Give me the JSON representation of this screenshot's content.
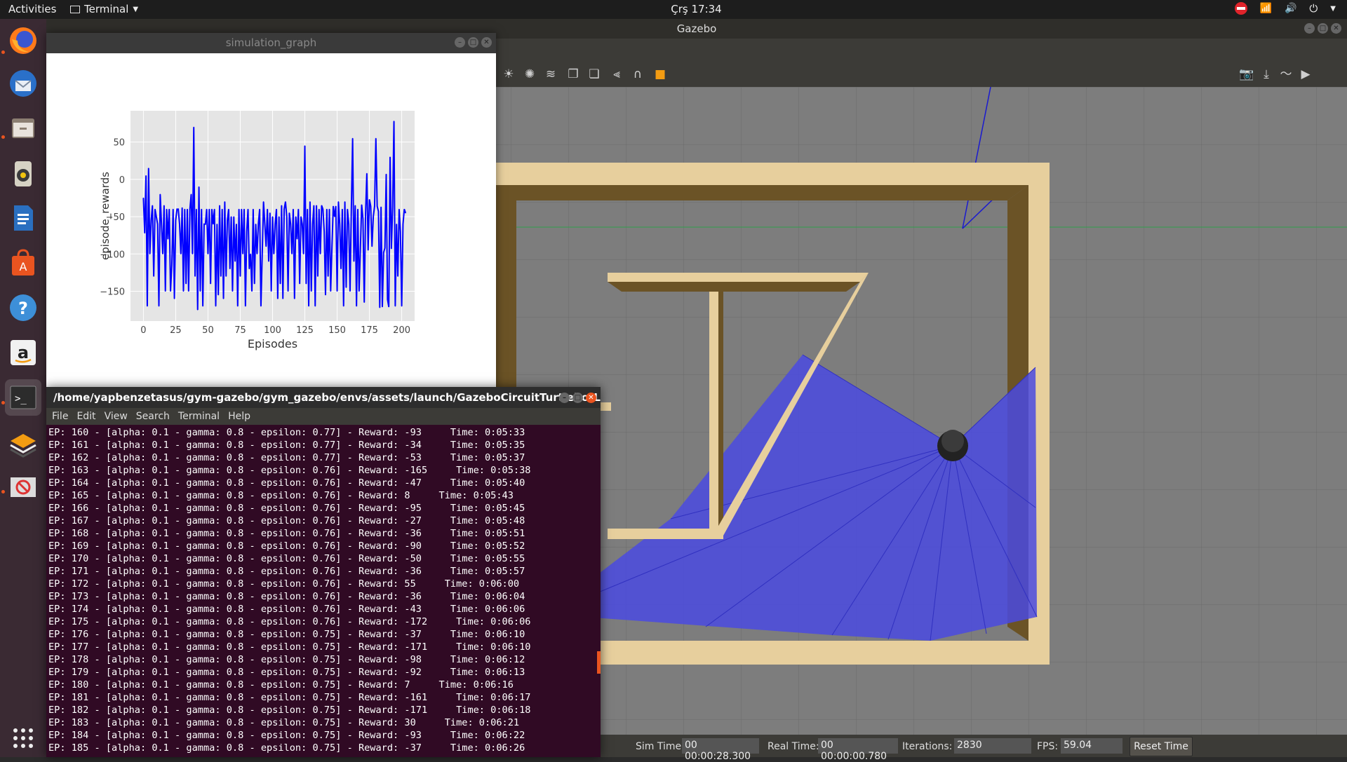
{
  "topbar": {
    "activities": "Activities",
    "app_menu": "Terminal",
    "clock": "Çrş 17:34"
  },
  "dock": {
    "items": [
      "firefox-icon",
      "thunderbird-icon",
      "files-icon",
      "rhythmbox-icon",
      "writer-icon",
      "software-center-icon",
      "help-icon",
      "amazon-icon",
      "terminal-icon",
      "gazebo-icon",
      "system-icon"
    ]
  },
  "gazebo": {
    "title": "Gazebo",
    "status": {
      "sim_time_label": "Sim Time:",
      "sim_time": "00 00:00:28.300",
      "real_time_label": "Real Time:",
      "real_time": "00 00:00:00.780",
      "iterations_label": "Iterations:",
      "iterations": "2830",
      "fps_label": "FPS:",
      "fps": "59.04",
      "reset_label": "Reset Time"
    }
  },
  "simgraph": {
    "title": "simulation_graph",
    "chart_data": {
      "type": "line",
      "xlabel": "Episodes",
      "ylabel": "episode_rewards",
      "xlim": [
        -10,
        210
      ],
      "ylim": [
        -190,
        92
      ],
      "xticks": [
        0,
        25,
        50,
        75,
        100,
        125,
        150,
        175,
        200
      ],
      "yticks": [
        50,
        0,
        -50,
        -100,
        -150
      ],
      "ytick_labels": [
        "50",
        "0",
        "−50",
        "−100",
        "−150"
      ],
      "color": "#0000ff",
      "series": [
        {
          "values": [
            -25,
            -72,
            5,
            -170,
            15,
            -100,
            -55,
            -35,
            -130,
            -40,
            -50,
            -60,
            -170,
            -20,
            -60,
            -100,
            -35,
            -150,
            -40,
            -80,
            -40,
            -150,
            -115,
            -40,
            -160,
            -55,
            -40,
            -40,
            -60,
            -100,
            -38,
            -150,
            -40,
            -140,
            -40,
            -150,
            -40,
            -20,
            -100,
            70,
            -130,
            -40,
            -175,
            -10,
            -150,
            -40,
            -170,
            -60,
            -60,
            -40,
            -100,
            -40,
            -140,
            -40,
            -60,
            -40,
            -170,
            -60,
            -155,
            -35,
            -130,
            -40,
            -160,
            -30,
            -130,
            -55,
            -40,
            -120,
            -50,
            -150,
            -50,
            -110,
            -60,
            -170,
            -40,
            -130,
            -40,
            -100,
            -40,
            -170,
            -70,
            -40,
            -120,
            -100,
            -150,
            -40,
            -140,
            -60,
            -100,
            -60,
            -40,
            -170,
            -100,
            -30,
            -60,
            -90,
            -40,
            -110,
            -45,
            -150,
            -50,
            -100,
            -60,
            -40,
            -160,
            -50,
            -140,
            -35,
            -160,
            -40,
            -30,
            -50,
            -150,
            -45,
            -60,
            -100,
            -40,
            -160,
            -50,
            -80,
            -40,
            -140,
            -50,
            -60,
            -100,
            45,
            -140,
            -40,
            -170,
            -30,
            -150,
            -60,
            -35,
            -170,
            -35,
            -130,
            -40,
            -100,
            -35,
            -40,
            -70,
            -155,
            -40,
            -130,
            -40,
            -150,
            -90,
            -36,
            -50,
            -36,
            -150,
            -30,
            -60,
            -120,
            -40,
            -170,
            -30,
            -145,
            -40,
            -60,
            -150,
            -40,
            55,
            -110,
            -35,
            -170,
            -40,
            -150,
            -93,
            -34,
            -53,
            -165,
            -47,
            8,
            -95,
            -27,
            -36,
            -90,
            -50,
            -36,
            55,
            -36,
            -43,
            -172,
            -37,
            -171,
            -98,
            -92,
            7,
            -161,
            -171,
            30,
            -93,
            -37,
            78,
            -170,
            -60,
            -130,
            -40,
            -70,
            -170,
            -60,
            -40,
            -45
          ]
        }
      ]
    }
  },
  "terminal": {
    "title": "/home/yapbenzetasus/gym-gazebo/gym_gazebo/envs/assets/launch/GazeboCircuitTurtlebotLidar_...",
    "menu": [
      "File",
      "Edit",
      "View",
      "Search",
      "Terminal",
      "Help"
    ],
    "lines": [
      "EP: 160 - [alpha: 0.1 - gamma: 0.8 - epsilon: 0.77] - Reward: -93     Time: 0:05:33",
      "EP: 161 - [alpha: 0.1 - gamma: 0.8 - epsilon: 0.77] - Reward: -34     Time: 0:05:35",
      "EP: 162 - [alpha: 0.1 - gamma: 0.8 - epsilon: 0.77] - Reward: -53     Time: 0:05:37",
      "EP: 163 - [alpha: 0.1 - gamma: 0.8 - epsilon: 0.76] - Reward: -165     Time: 0:05:38",
      "EP: 164 - [alpha: 0.1 - gamma: 0.8 - epsilon: 0.76] - Reward: -47     Time: 0:05:40",
      "EP: 165 - [alpha: 0.1 - gamma: 0.8 - epsilon: 0.76] - Reward: 8     Time: 0:05:43",
      "EP: 166 - [alpha: 0.1 - gamma: 0.8 - epsilon: 0.76] - Reward: -95     Time: 0:05:45",
      "EP: 167 - [alpha: 0.1 - gamma: 0.8 - epsilon: 0.76] - Reward: -27     Time: 0:05:48",
      "EP: 168 - [alpha: 0.1 - gamma: 0.8 - epsilon: 0.76] - Reward: -36     Time: 0:05:51",
      "EP: 169 - [alpha: 0.1 - gamma: 0.8 - epsilon: 0.76] - Reward: -90     Time: 0:05:52",
      "EP: 170 - [alpha: 0.1 - gamma: 0.8 - epsilon: 0.76] - Reward: -50     Time: 0:05:55",
      "EP: 171 - [alpha: 0.1 - gamma: 0.8 - epsilon: 0.76] - Reward: -36     Time: 0:05:57",
      "EP: 172 - [alpha: 0.1 - gamma: 0.8 - epsilon: 0.76] - Reward: 55     Time: 0:06:00",
      "EP: 173 - [alpha: 0.1 - gamma: 0.8 - epsilon: 0.76] - Reward: -36     Time: 0:06:04",
      "EP: 174 - [alpha: 0.1 - gamma: 0.8 - epsilon: 0.76] - Reward: -43     Time: 0:06:06",
      "EP: 175 - [alpha: 0.1 - gamma: 0.8 - epsilon: 0.76] - Reward: -172     Time: 0:06:06",
      "EP: 176 - [alpha: 0.1 - gamma: 0.8 - epsilon: 0.75] - Reward: -37     Time: 0:06:10",
      "EP: 177 - [alpha: 0.1 - gamma: 0.8 - epsilon: 0.75] - Reward: -171     Time: 0:06:10",
      "EP: 178 - [alpha: 0.1 - gamma: 0.8 - epsilon: 0.75] - Reward: -98     Time: 0:06:12",
      "EP: 179 - [alpha: 0.1 - gamma: 0.8 - epsilon: 0.75] - Reward: -92     Time: 0:06:13",
      "EP: 180 - [alpha: 0.1 - gamma: 0.8 - epsilon: 0.75] - Reward: 7     Time: 0:06:16",
      "EP: 181 - [alpha: 0.1 - gamma: 0.8 - epsilon: 0.75] - Reward: -161     Time: 0:06:17",
      "EP: 182 - [alpha: 0.1 - gamma: 0.8 - epsilon: 0.75] - Reward: -171     Time: 0:06:18",
      "EP: 183 - [alpha: 0.1 - gamma: 0.8 - epsilon: 0.75] - Reward: 30     Time: 0:06:21",
      "EP: 184 - [alpha: 0.1 - gamma: 0.8 - epsilon: 0.75] - Reward: -93     Time: 0:06:22",
      "EP: 185 - [alpha: 0.1 - gamma: 0.8 - epsilon: 0.75] - Reward: -37     Time: 0:06:26"
    ]
  }
}
